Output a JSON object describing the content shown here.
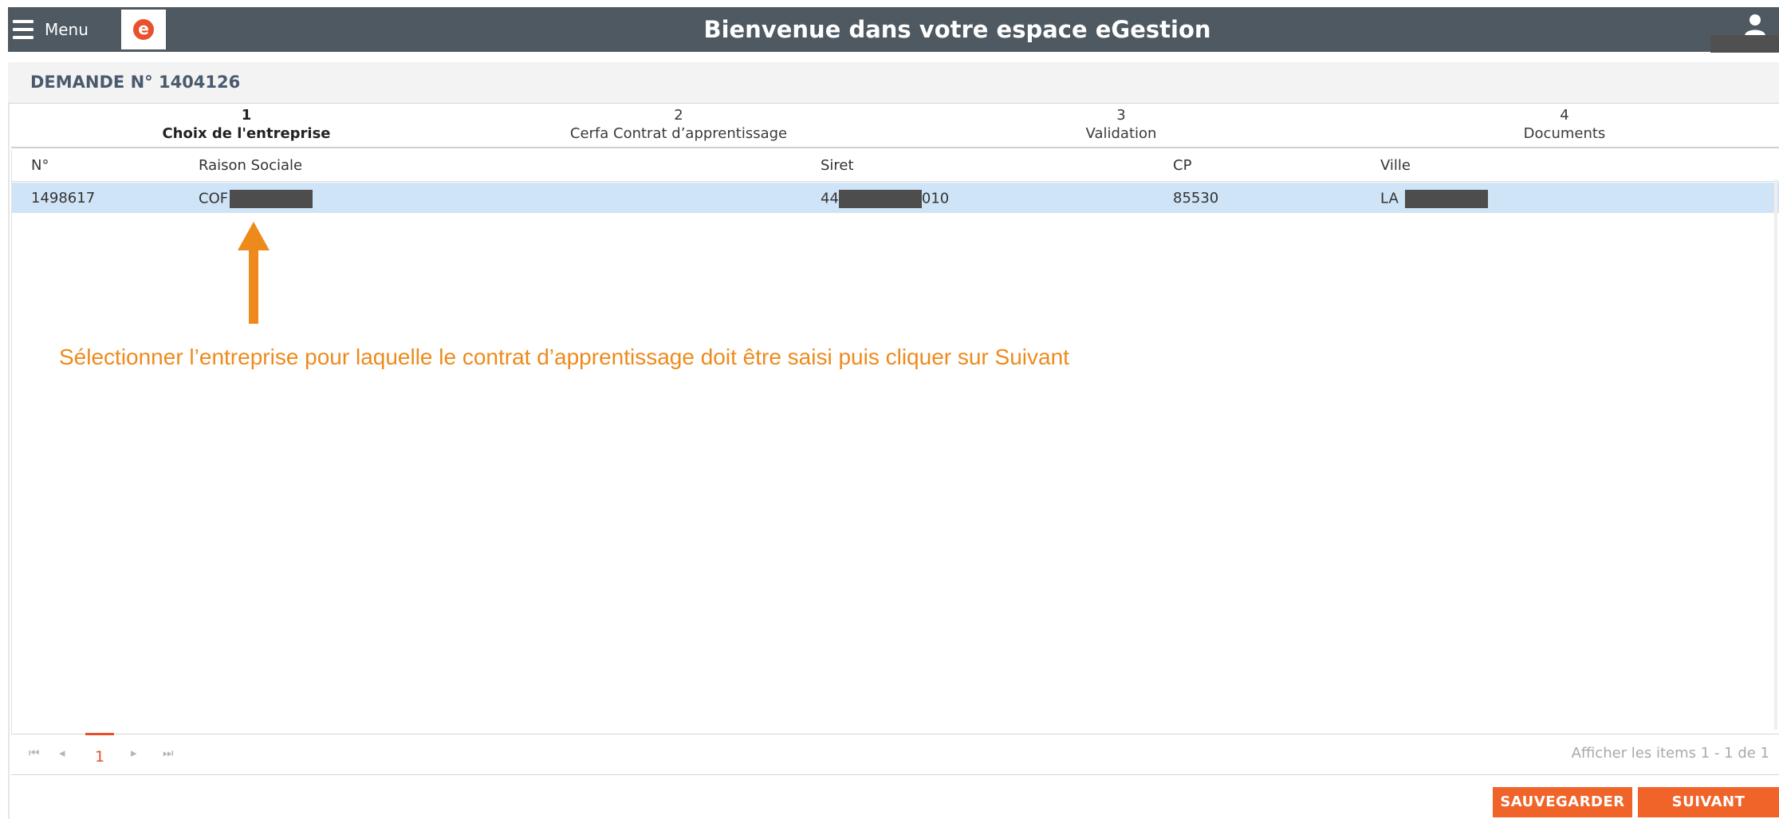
{
  "header": {
    "menu_label": "Menu",
    "title": "Bienvenue dans votre espace eGestion",
    "logo_glyph": "e",
    "colors": {
      "bar": "#4f5961",
      "accent": "#f0642a"
    }
  },
  "demande": {
    "title": "DEMANDE N° 1404126"
  },
  "steps": [
    {
      "number": "1",
      "label": "Choix de l'entreprise",
      "active": true
    },
    {
      "number": "2",
      "label": "Cerfa Contrat d’apprentissage",
      "active": false
    },
    {
      "number": "3",
      "label": "Validation",
      "active": false
    },
    {
      "number": "4",
      "label": "Documents",
      "active": false
    }
  ],
  "table": {
    "columns": [
      "N°",
      "Raison Sociale",
      "Siret",
      "CP",
      "Ville"
    ],
    "rows": [
      {
        "numero": "1498617",
        "raison_sociale": "COF",
        "siret_prefix": "44",
        "siret_suffix": "010",
        "cp": "85530",
        "ville": "LA"
      }
    ]
  },
  "annotation": {
    "text": "Sélectionner l’entreprise pour laquelle le contrat d’apprentissage doit être saisi puis cliquer sur Suivant",
    "color": "#ee8a1c"
  },
  "pager": {
    "current_page": "1",
    "info": "Afficher les items 1 - 1 de 1",
    "icons": [
      "first-page-icon",
      "prev-page-icon",
      "next-page-icon",
      "last-page-icon"
    ]
  },
  "actions": {
    "save_label": "SAUVEGARDER",
    "next_label": "SUIVANT"
  }
}
